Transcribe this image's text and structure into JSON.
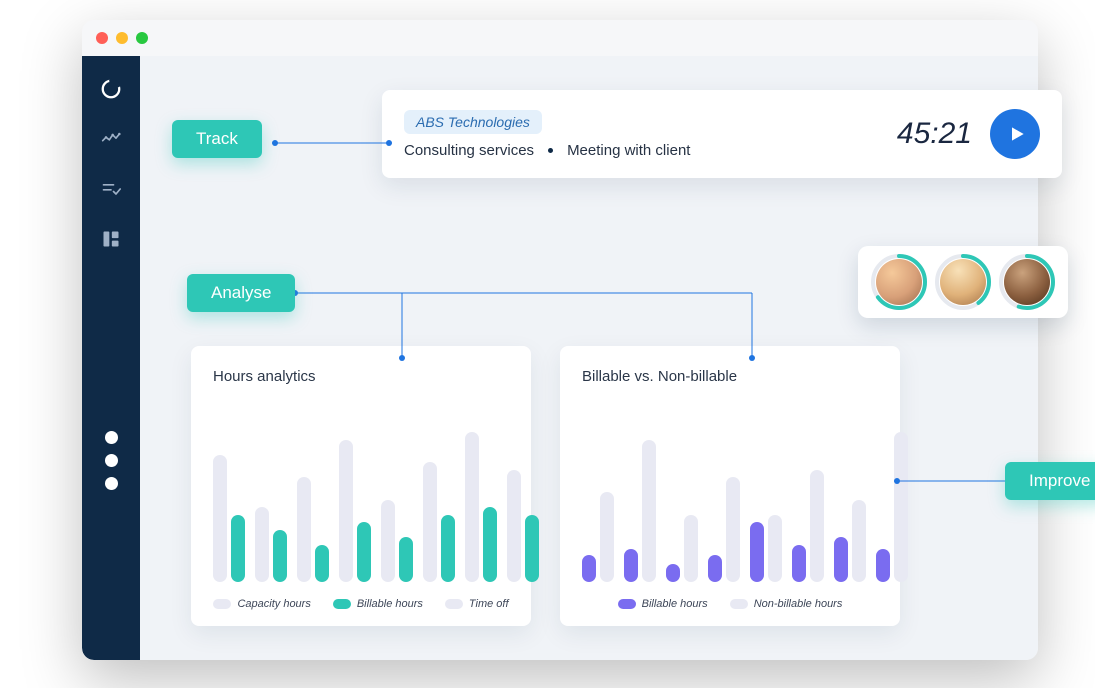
{
  "tags": {
    "track": "Track",
    "analyse": "Analyse",
    "improve": "Improve"
  },
  "timer_card": {
    "project": "ABS Technologies",
    "category": "Consulting services",
    "task": "Meeting with client",
    "elapsed": "45:21"
  },
  "avatars": {
    "progress": [
      0.65,
      0.4,
      0.55
    ]
  },
  "chart_data": [
    {
      "type": "bar",
      "title": "Hours analytics",
      "series": [
        {
          "name": "Capacity hours",
          "values": [
            85,
            50,
            70,
            95,
            55,
            80,
            100,
            75
          ]
        },
        {
          "name": "Billable hours",
          "values": [
            45,
            35,
            25,
            40,
            30,
            45,
            50,
            45
          ]
        },
        {
          "name": "Time off",
          "values": [
            0,
            0,
            0,
            0,
            0,
            0,
            0,
            0
          ]
        }
      ],
      "legend": [
        "Capacity hours",
        "Billable hours",
        "Time off"
      ],
      "ylim": [
        0,
        100
      ],
      "colors": {
        "Capacity hours": "#e8e9f3",
        "Billable hours": "#2ec7b6",
        "Time off": "#e8e9f3"
      }
    },
    {
      "type": "bar",
      "title": "Billable vs. Non-billable",
      "series": [
        {
          "name": "Billable hours",
          "values": [
            18,
            22,
            12,
            18,
            40,
            25,
            30,
            22
          ]
        },
        {
          "name": "Non-billable hours",
          "values": [
            60,
            95,
            45,
            70,
            45,
            75,
            55,
            100
          ]
        }
      ],
      "legend": [
        "Billable hours",
        "Non-billable hours"
      ],
      "ylim": [
        0,
        100
      ],
      "colors": {
        "Billable hours": "#7a6cf0",
        "Non-billable hours": "#e8e9f3"
      }
    }
  ]
}
